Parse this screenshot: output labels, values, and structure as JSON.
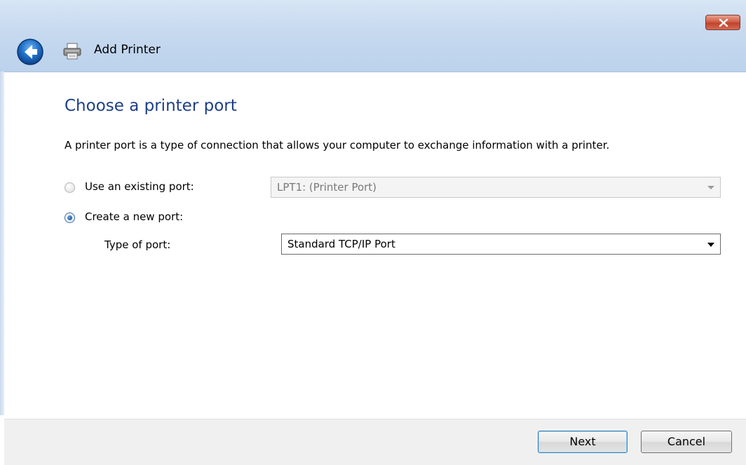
{
  "window": {
    "title": "Add Printer"
  },
  "page": {
    "heading": "Choose a printer port",
    "description": "A printer port is a type of connection that allows your computer to exchange information with a printer."
  },
  "options": {
    "existing": {
      "label": "Use an existing port:",
      "checked": false,
      "value": "LPT1: (Printer Port)",
      "enabled": false
    },
    "create": {
      "label": "Create a new port:",
      "checked": true
    },
    "type_of_port": {
      "label": "Type of port:",
      "value": "Standard TCP/IP Port",
      "enabled": true
    }
  },
  "footer": {
    "next_label": "Next",
    "cancel_label": "Cancel"
  },
  "icons": {
    "back": "back-arrow-icon",
    "printer": "printer-icon",
    "close": "close-icon"
  },
  "colors": {
    "heading": "#1e3f87",
    "titlebar": "#c6d9ef",
    "close_button": "#c0442c"
  }
}
